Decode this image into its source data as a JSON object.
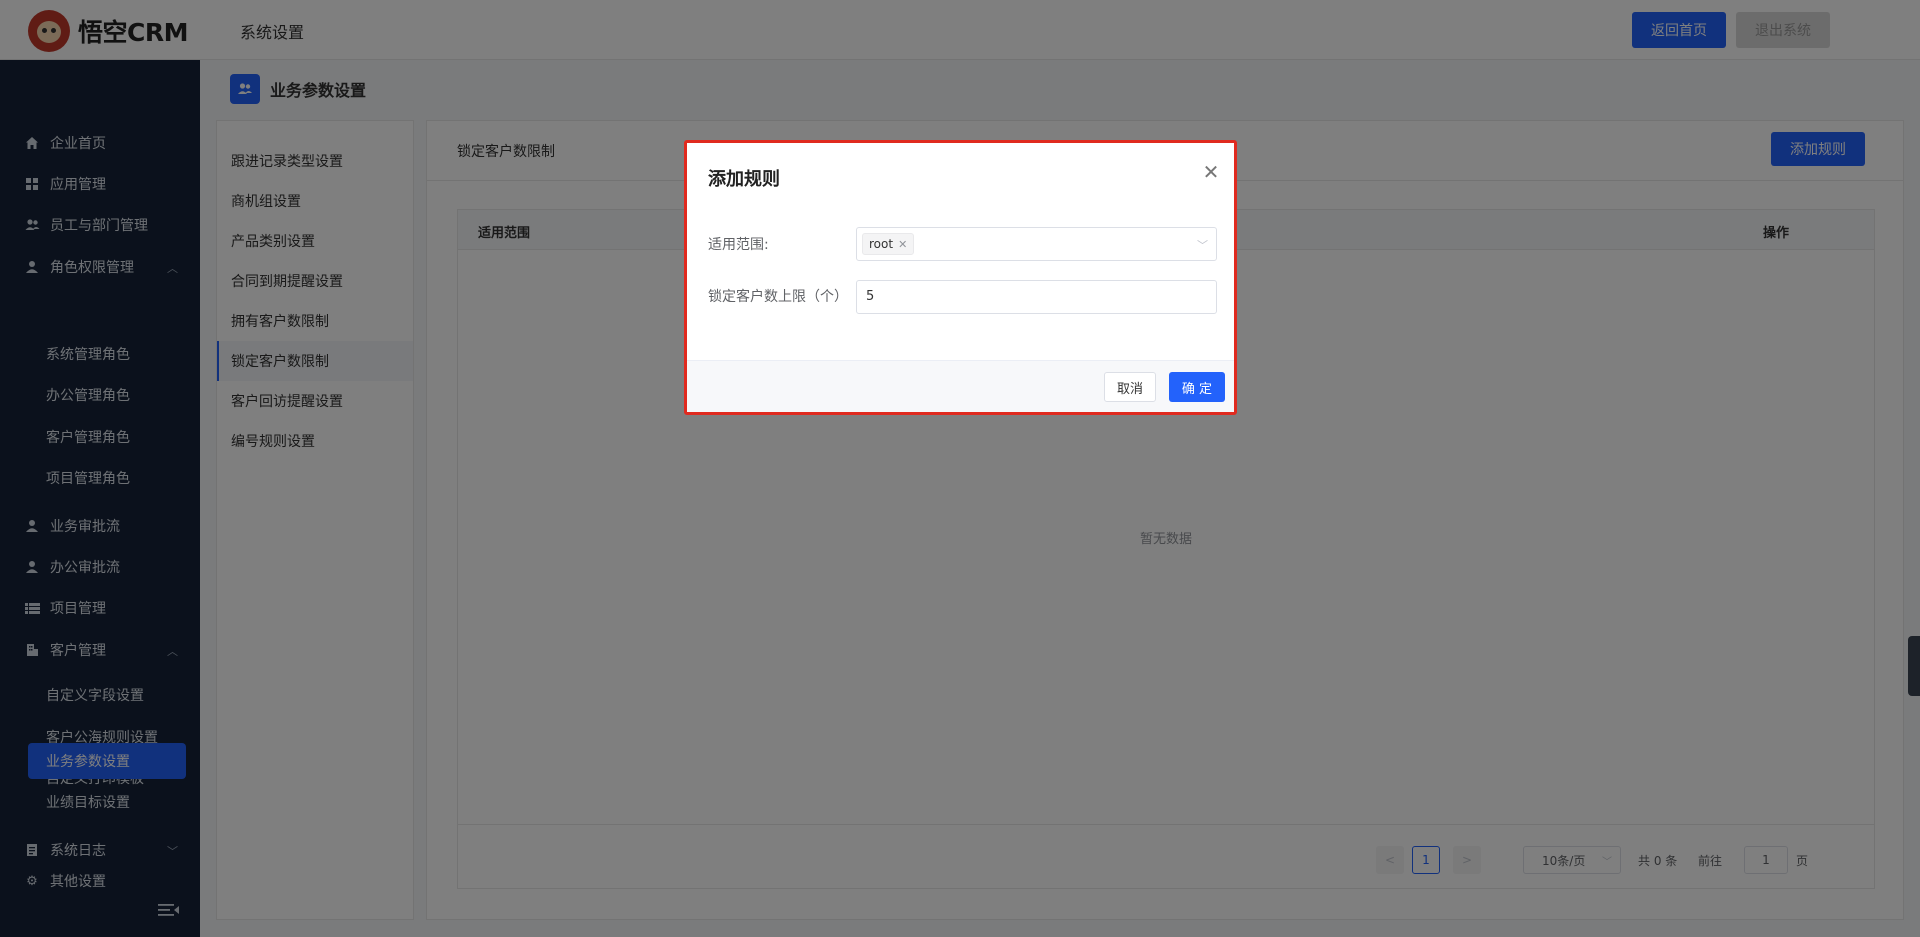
{
  "header": {
    "logo_text": "悟空CRM",
    "title": "系统设置",
    "home_button": "返回首页",
    "logout_button": "退出系统"
  },
  "sidebar": {
    "items": [
      {
        "label": "企业首页",
        "icon": "home-icon"
      },
      {
        "label": "应用管理",
        "icon": "grid-icon"
      },
      {
        "label": "员工与部门管理",
        "icon": "users-icon"
      },
      {
        "label": "角色权限管理",
        "icon": "user-icon",
        "expanded": true
      },
      {
        "label": "系统管理角色"
      },
      {
        "label": "办公管理角色"
      },
      {
        "label": "客户管理角色"
      },
      {
        "label": "项目管理角色"
      },
      {
        "label": "业务审批流",
        "icon": "user-icon"
      },
      {
        "label": "办公审批流",
        "icon": "user-icon"
      },
      {
        "label": "项目管理",
        "icon": "list-icon"
      },
      {
        "label": "客户管理",
        "icon": "building-icon",
        "expanded": true
      },
      {
        "label": "自定义字段设置"
      },
      {
        "label": "客户公海规则设置"
      },
      {
        "label": "自定义打印模板"
      },
      {
        "label": "业务参数设置",
        "active": true
      },
      {
        "label": "业绩目标设置"
      },
      {
        "label": "系统日志",
        "icon": "doc-icon",
        "expanded": false
      },
      {
        "label": "其他设置",
        "icon": "gear-icon"
      }
    ]
  },
  "page": {
    "title": "业务参数设置"
  },
  "left_menu": {
    "items": [
      {
        "label": "跟进记录类型设置"
      },
      {
        "label": "商机组设置"
      },
      {
        "label": "产品类别设置"
      },
      {
        "label": "合同到期提醒设置"
      },
      {
        "label": "拥有客户数限制"
      },
      {
        "label": "锁定客户数限制",
        "active": true
      },
      {
        "label": "客户回访提醒设置"
      },
      {
        "label": "编号规则设置"
      }
    ]
  },
  "panel": {
    "title": "锁定客户数限制",
    "add_button": "添加规则",
    "columns": [
      "适用范围",
      "操作"
    ],
    "empty_text": "暂无数据"
  },
  "pagination": {
    "prev": "<",
    "current": "1",
    "next": ">",
    "page_size": "10条/页",
    "total": "共 0 条",
    "goto_label": "前往",
    "goto_value": "1",
    "page_suffix": "页"
  },
  "dialog": {
    "title": "添加规则",
    "scope_label": "适用范围:",
    "scope_tag": "root",
    "limit_label": "锁定客户数上限（个）",
    "limit_value": "5",
    "cancel_button": "取消",
    "ok_button": "确 定"
  },
  "colors": {
    "primary": "#2362fb",
    "sidebar_bg": "#162338",
    "dialog_highlight": "#e02a1f"
  }
}
